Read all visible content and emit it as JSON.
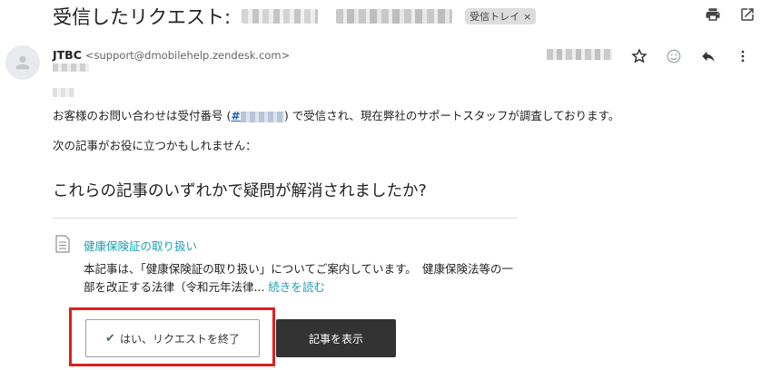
{
  "subject": {
    "title": "受信したリクエスト:",
    "label_chip": "受信トレイ",
    "label_chip_close": "×"
  },
  "sender": {
    "name": "JTBC",
    "email": "<support@dmobilehelp.zendesk.com>"
  },
  "body": {
    "line1_before": "お客様のお問い合わせは受付番号 (",
    "ticket_prefix": "#",
    "line1_after": ") で受信され、現在弊社のサポートスタッフが調査しております。",
    "line2": "次の記事がお役に立つかもしれません：",
    "heading": "これらの記事のいずれかで疑問が解消されましたか?",
    "article": {
      "title": "健康保険証の取り扱い",
      "description": "本記事は、「健康保険証の取り扱い」についてご案内しています。　健康保険法等の一部を改正する法律（令和元年法律...",
      "read_more": "続きを読む"
    }
  },
  "buttons": {
    "done_check": "✔",
    "done": "はい、リクエストを終了",
    "view": "記事を表示"
  },
  "colors": {
    "link": "#1a56c4",
    "article_link": "#1a9fb5",
    "highlight": "#e01e1e",
    "dark_button": "#333333"
  },
  "icons": [
    "print-icon",
    "open-in-new-icon",
    "star-icon",
    "emoji-icon",
    "reply-icon",
    "more-vert-icon",
    "avatar-icon",
    "document-icon"
  ]
}
